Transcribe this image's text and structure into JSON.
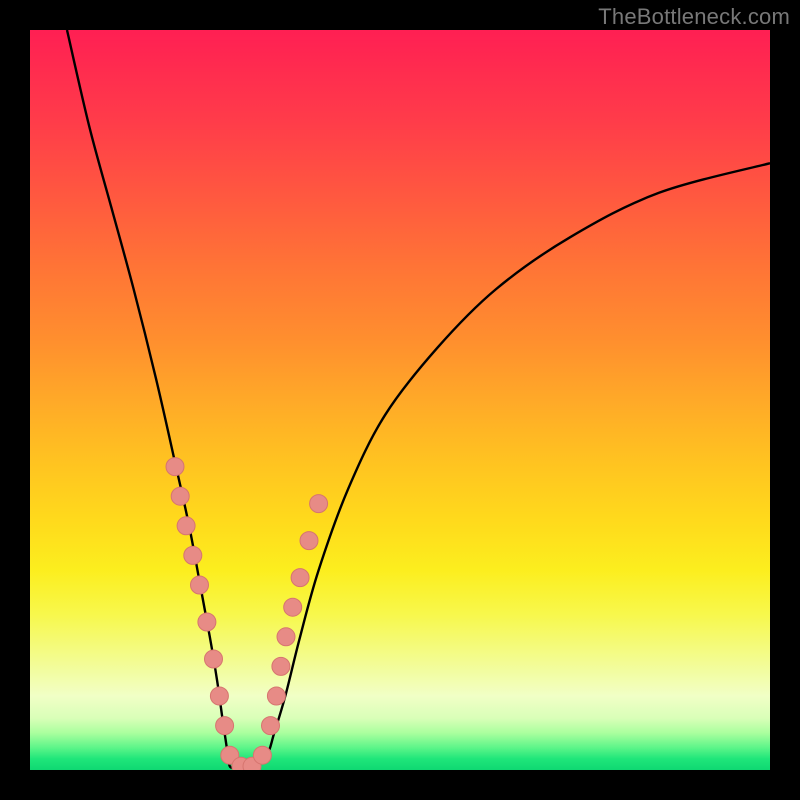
{
  "watermark": "TheBottleneck.com",
  "colors": {
    "background": "#000000",
    "curve": "#000000",
    "marker_fill": "#e78b86",
    "marker_stroke": "#d6756f",
    "watermark_text": "#787878",
    "gradient_top": "#ff1f53",
    "gradient_bottom": "#0fd872"
  },
  "chart_data": {
    "type": "line",
    "title": "",
    "xlabel": "",
    "ylabel": "",
    "xlim": [
      0,
      100
    ],
    "ylim": [
      0,
      100
    ],
    "grid": false,
    "legend": false,
    "notes": "V-shaped bottleneck curve over a vertical red→yellow→green gradient. No axis ticks or labels are present in the image; x/y values are estimated from pixel position on a 0–100 normalized scale.",
    "series": [
      {
        "name": "bottleneck-curve",
        "x": [
          5,
          8,
          11,
          14,
          17,
          19.5,
          21.5,
          23,
          24.3,
          25.3,
          26,
          26.6,
          27,
          28,
          30,
          32,
          33,
          34.5,
          36.5,
          39,
          43,
          48,
          55,
          63,
          73,
          85,
          100
        ],
        "y": [
          100,
          87,
          76,
          65,
          53,
          42,
          33,
          25,
          18,
          12,
          7,
          3,
          0.5,
          0.5,
          0.5,
          2,
          5,
          10,
          18,
          27,
          38,
          48,
          57,
          65,
          72,
          78,
          82
        ]
      }
    ],
    "markers": {
      "name": "highlighted-points",
      "color": "#e78b86",
      "x": [
        19.6,
        20.3,
        21.1,
        22.0,
        22.9,
        23.9,
        24.8,
        25.6,
        26.3,
        27.0,
        28.5,
        30.0,
        31.4,
        32.5,
        33.3,
        33.9,
        34.6,
        35.5,
        36.5,
        37.7,
        39.0
      ],
      "y": [
        41,
        37,
        33,
        29,
        25,
        20,
        15,
        10,
        6,
        2,
        0.5,
        0.5,
        2,
        6,
        10,
        14,
        18,
        22,
        26,
        31,
        36
      ]
    }
  }
}
